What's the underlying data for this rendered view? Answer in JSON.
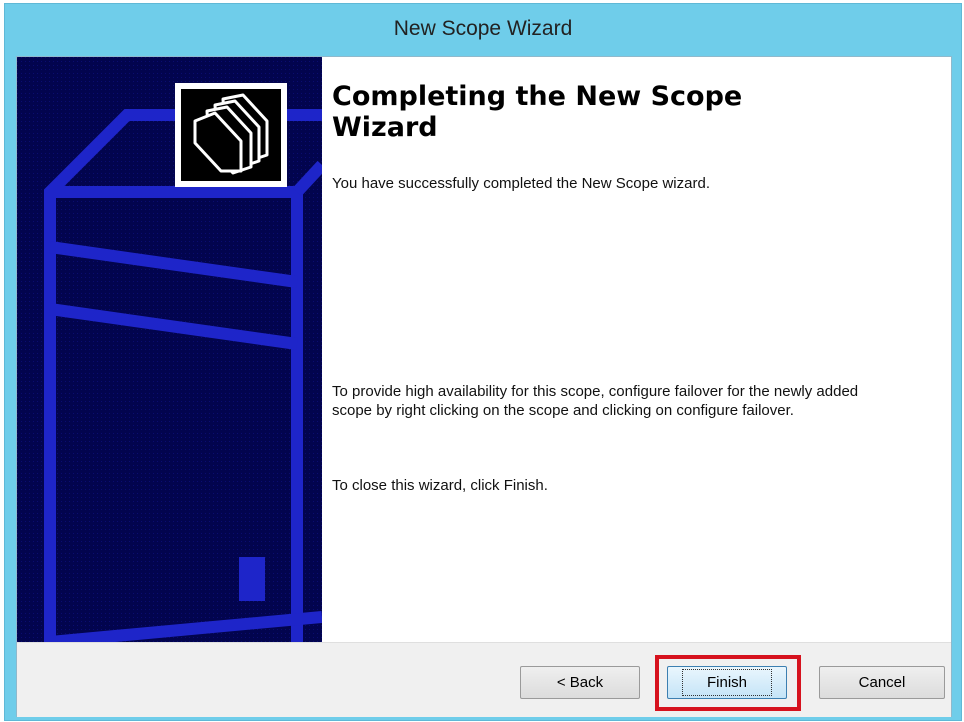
{
  "window": {
    "title": "New Scope Wizard"
  },
  "content": {
    "heading": "Completing the New Scope Wizard",
    "paragraph1": "You have successfully completed the New Scope wizard.",
    "paragraph2": "To provide high availability for this scope, configure failover for the newly added scope by right clicking on the scope and clicking on configure failover.",
    "paragraph3": "To close this wizard, click Finish."
  },
  "side_panel": {
    "logo_icon": "folders-icon",
    "color": "#02044e"
  },
  "buttons": {
    "back": "< Back",
    "finish": "Finish",
    "cancel": "Cancel"
  },
  "colors": {
    "titlebar": "#6fcdea",
    "highlight": "#d6121e"
  }
}
